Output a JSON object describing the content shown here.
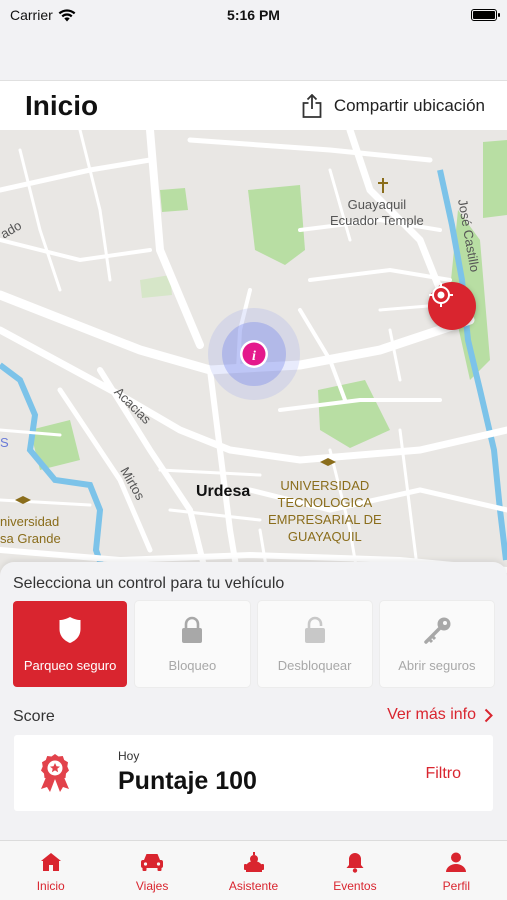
{
  "status_bar": {
    "carrier": "Carrier",
    "time": "5:16 PM",
    "battery_level": 1.0
  },
  "header": {
    "title": "Inicio",
    "share_label": "Compartir ubicación"
  },
  "map": {
    "labels": {
      "temple": "Guayaquil\nEcuador Temple",
      "street_jose_castillo": "José Castillo",
      "street_acacias": "Acacias",
      "street_mirtos": "Mirtos",
      "street_ado": "ado",
      "district": "Urdesa",
      "university_right": "UNIVERSIDAD\nTECNOLOGICA\nEMPRESARIAL DE\nGUAYAQUIL",
      "university_left": "niversidad\nsa Grande",
      "edge_s": "S"
    },
    "colors": {
      "water": "#7cc3e9",
      "park": "#b8dea3",
      "road": "#ffffff",
      "land": "#e9e7e4",
      "accent": "#d9252f",
      "pin": "#e4198c"
    }
  },
  "sheet": {
    "title": "Selecciona un control para tu vehículo",
    "controls": [
      {
        "label": "Parqueo seguro",
        "icon": "shield-icon",
        "active": true
      },
      {
        "label": "Bloqueo",
        "icon": "lock-icon",
        "active": false
      },
      {
        "label": "Desbloquear",
        "icon": "unlock-icon",
        "active": false
      },
      {
        "label": "Abrir seguros",
        "icon": "key-icon",
        "active": false
      }
    ],
    "score_label": "Score",
    "more_info": "Ver más info",
    "score_card": {
      "sub": "Hoy",
      "value": "Puntaje 100",
      "filter": "Filtro"
    }
  },
  "tabbar": [
    {
      "label": "Inicio",
      "icon": "home-icon"
    },
    {
      "label": "Viajes",
      "icon": "car-icon"
    },
    {
      "label": "Asistente",
      "icon": "assistant-icon"
    },
    {
      "label": "Eventos",
      "icon": "bell-icon"
    },
    {
      "label": "Perfil",
      "icon": "user-icon"
    }
  ]
}
